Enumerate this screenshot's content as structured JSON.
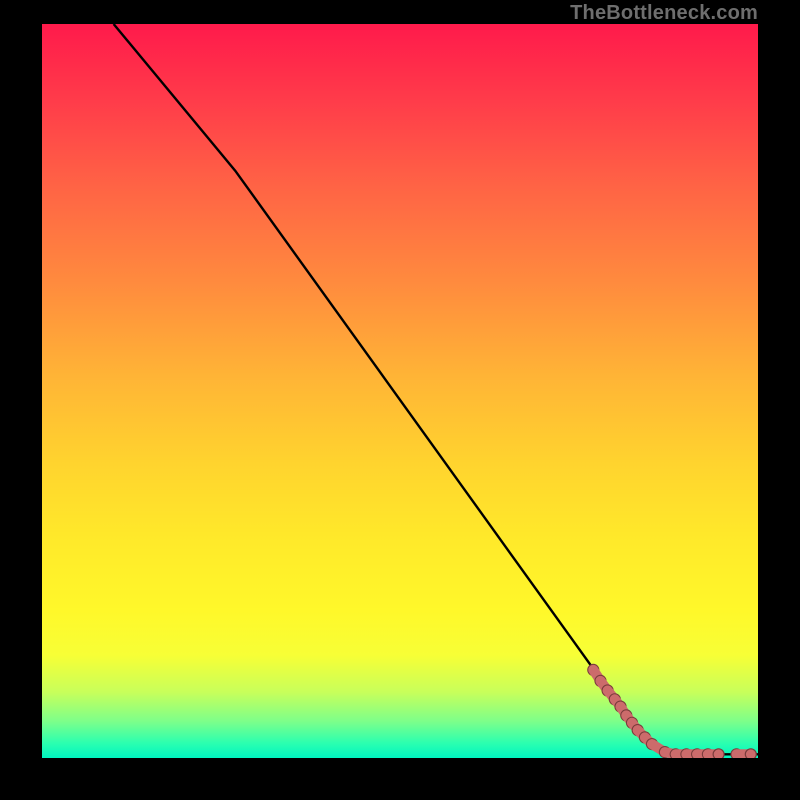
{
  "watermark": "TheBottleneck.com",
  "colors": {
    "background": "#000000",
    "line": "#000000",
    "marker_fill": "#cc6b6b",
    "marker_stroke": "#7a3c3c"
  },
  "chart_data": {
    "type": "line",
    "title": "",
    "xlabel": "",
    "ylabel": "",
    "xlim": [
      0,
      100
    ],
    "ylim": [
      0,
      100
    ],
    "grid": false,
    "legend": false,
    "series": [
      {
        "name": "bottleneck-curve",
        "x": [
          10,
          27,
          83,
          88,
          100
        ],
        "y": [
          100,
          80,
          4,
          0.5,
          0.5
        ]
      }
    ],
    "markers": {
      "name": "highlighted-range",
      "comment": "Dense salmon markers clustered near the elbow and tail of the curve.",
      "points": [
        {
          "x": 77.0,
          "y": 12.0
        },
        {
          "x": 78.0,
          "y": 10.5
        },
        {
          "x": 79.0,
          "y": 9.2
        },
        {
          "x": 80.0,
          "y": 8.0
        },
        {
          "x": 80.8,
          "y": 7.0
        },
        {
          "x": 81.6,
          "y": 5.8
        },
        {
          "x": 82.4,
          "y": 4.8
        },
        {
          "x": 83.2,
          "y": 3.8
        },
        {
          "x": 84.2,
          "y": 2.8
        },
        {
          "x": 85.2,
          "y": 1.9
        },
        {
          "x": 87.0,
          "y": 0.8
        },
        {
          "x": 88.5,
          "y": 0.5
        },
        {
          "x": 90.0,
          "y": 0.5
        },
        {
          "x": 91.5,
          "y": 0.5
        },
        {
          "x": 93.0,
          "y": 0.5
        },
        {
          "x": 94.5,
          "y": 0.5
        },
        {
          "x": 97.0,
          "y": 0.5
        },
        {
          "x": 99.0,
          "y": 0.5
        }
      ]
    }
  }
}
